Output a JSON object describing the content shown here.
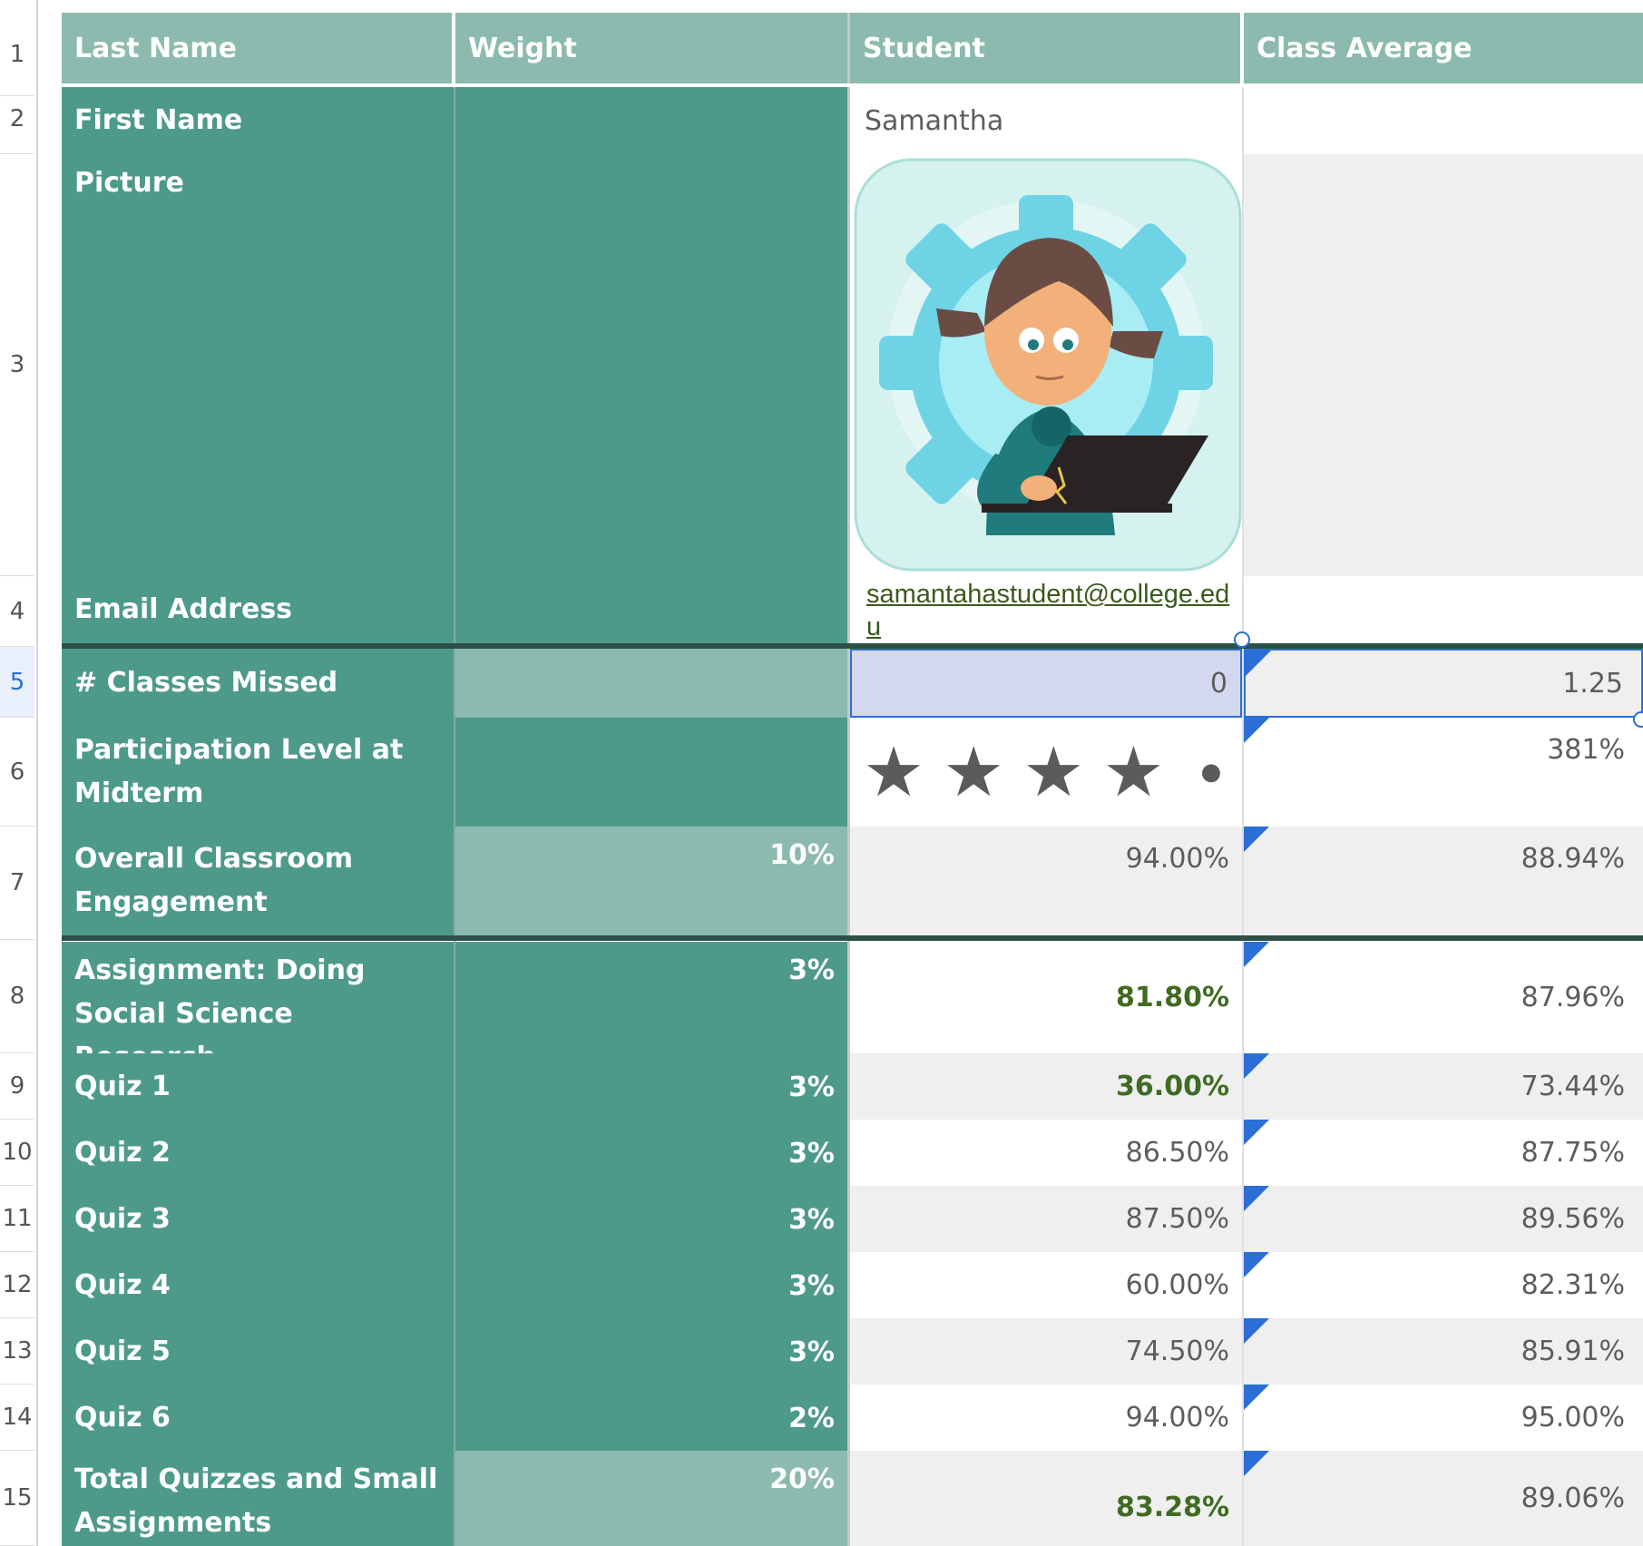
{
  "headers": {
    "c1": "Last Name",
    "c2": "Weight",
    "c3": "Student",
    "c4": "Class Average"
  },
  "row_numbers": [
    "1",
    "2",
    "3",
    "4",
    "5",
    "6",
    "7",
    "8",
    "9",
    "10",
    "11",
    "12",
    "13",
    "14",
    "15"
  ],
  "rows": {
    "first_name": {
      "label": "First Name",
      "student": "Samantha"
    },
    "picture": {
      "label": "Picture"
    },
    "email": {
      "label": "Email Address",
      "student": "samantahastudent@college.edu"
    },
    "classes_missed": {
      "label": "# Classes Missed",
      "student": "0",
      "average": "1.25"
    },
    "participation": {
      "label": "Participation Level at Midterm",
      "stars": 4,
      "star_total": 5,
      "average": "381%"
    },
    "engagement": {
      "label": "Overall Classroom Engagement",
      "weight": "10%",
      "student": "94.00%",
      "average": "88.94%"
    },
    "assignment": {
      "label": "Assignment: Doing Social Science Research",
      "weight": "3%",
      "student": "81.80%",
      "average": "87.96%"
    },
    "quiz1": {
      "label": "Quiz 1",
      "weight": "3%",
      "student": "36.00%",
      "average": "73.44%"
    },
    "quiz2": {
      "label": "Quiz 2",
      "weight": "3%",
      "student": "86.50%",
      "average": "87.75%"
    },
    "quiz3": {
      "label": "Quiz 3",
      "weight": "3%",
      "student": "87.50%",
      "average": "89.56%"
    },
    "quiz4": {
      "label": "Quiz 4",
      "weight": "3%",
      "student": "60.00%",
      "average": "82.31%"
    },
    "quiz5": {
      "label": "Quiz 5",
      "weight": "3%",
      "student": "74.50%",
      "average": "85.91%"
    },
    "quiz6": {
      "label": "Quiz 6",
      "weight": "2%",
      "student": "94.00%",
      "average": "95.00%"
    },
    "total": {
      "label": "Total Quizzes and Small Assignments",
      "weight": "20%",
      "student": "83.28%",
      "average": "89.06%"
    }
  },
  "colors": {
    "header": "#8cbaae",
    "label_bg": "#4e9a8a",
    "accent_green": "#3f6b22",
    "selection": "#2b6fd6"
  }
}
